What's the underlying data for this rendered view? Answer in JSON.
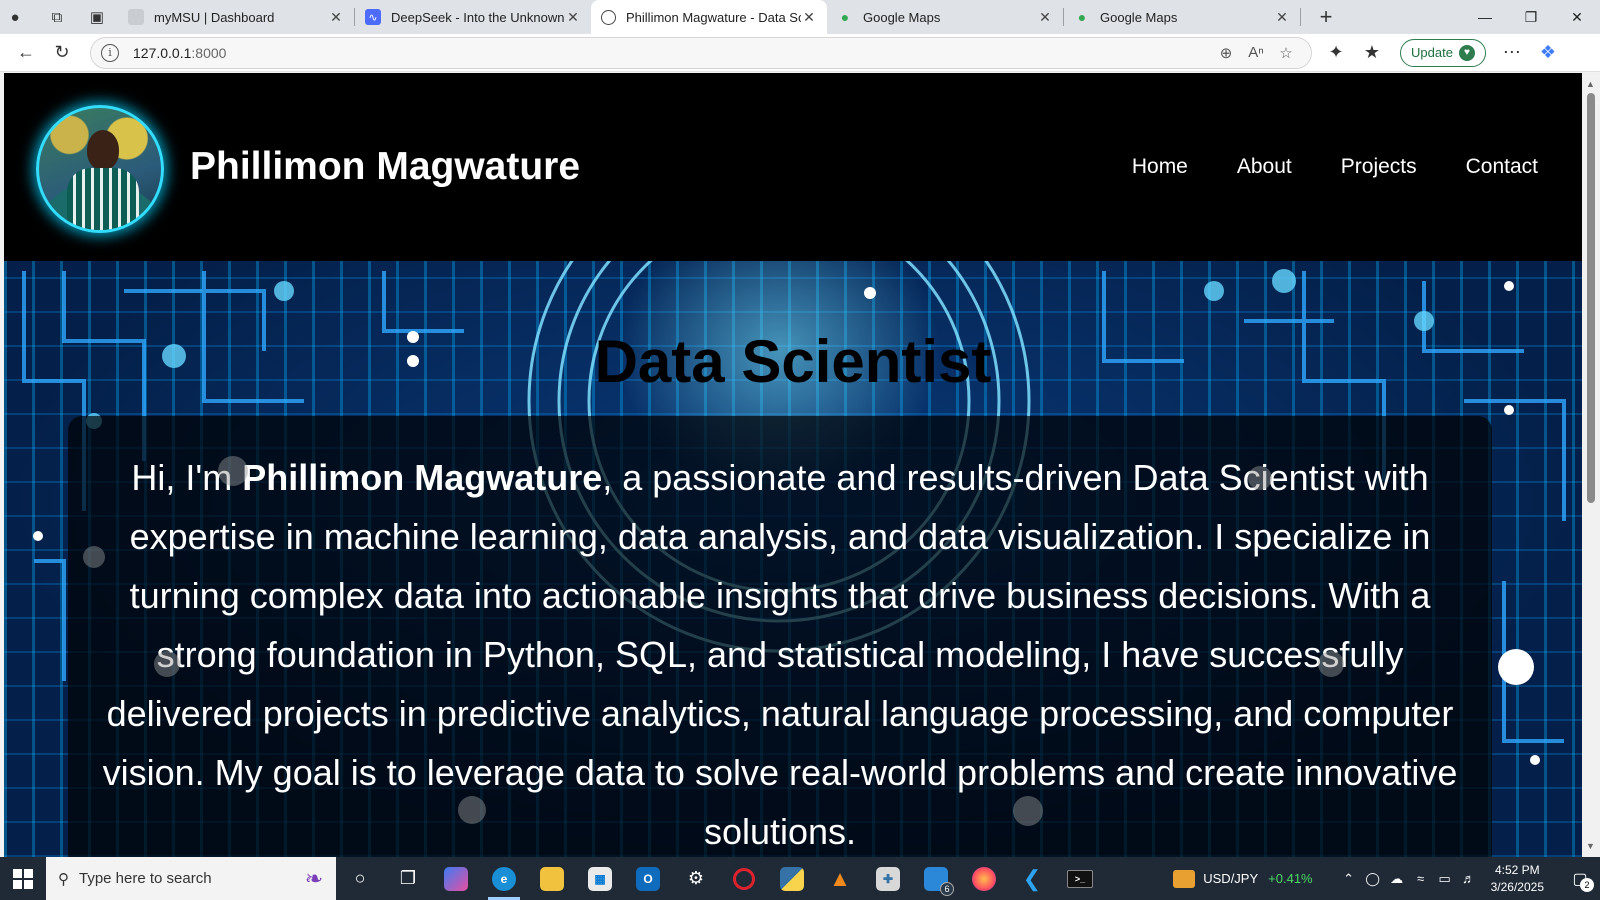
{
  "browser": {
    "tabs": [
      {
        "title": "myMSU | Dashboard",
        "icon": "doc-icon",
        "active": false
      },
      {
        "title": "DeepSeek - Into the Unknown",
        "icon": "deepseek-icon",
        "active": false
      },
      {
        "title": "Phillimon Magwature - Data Scier",
        "icon": "globe-icon",
        "active": true
      },
      {
        "title": "Google Maps",
        "icon": "maps-pin-icon",
        "active": false
      },
      {
        "title": "Google Maps",
        "icon": "maps-pin-icon",
        "active": false
      }
    ],
    "address": {
      "host": "127.0.0.1",
      "port": ":8000"
    },
    "update_label": "Update"
  },
  "site": {
    "brand": "Phillimon Magwature",
    "nav": [
      "Home",
      "About",
      "Projects",
      "Contact"
    ],
    "hero_title": "Data Scientist",
    "intro": {
      "prefix": "Hi, I'm ",
      "name": "Phillimon Magwature",
      "body": ", a passionate and results-driven Data Scientist with expertise in machine learning, data analysis, and data visualization. I specialize in turning complex data into actionable insights that drive business decisions. With a strong foundation in Python, SQL, and statistical modeling, I have successfully delivered projects in predictive analytics, natural language processing, and computer vision. My goal is to leverage data to solve real-world problems and create innovative solutions."
    }
  },
  "taskbar": {
    "search_placeholder": "Type here to search",
    "file_explorer_badge": "6",
    "ticker": {
      "symbol": "USD/JPY",
      "change": "+0.41%"
    },
    "time": "4:52 PM",
    "date": "3/26/2025",
    "notifications": "2"
  },
  "colors": {
    "accent_glow": "#33ddff",
    "ticker_up": "#4cd964",
    "update_green": "#2f7d4f"
  }
}
